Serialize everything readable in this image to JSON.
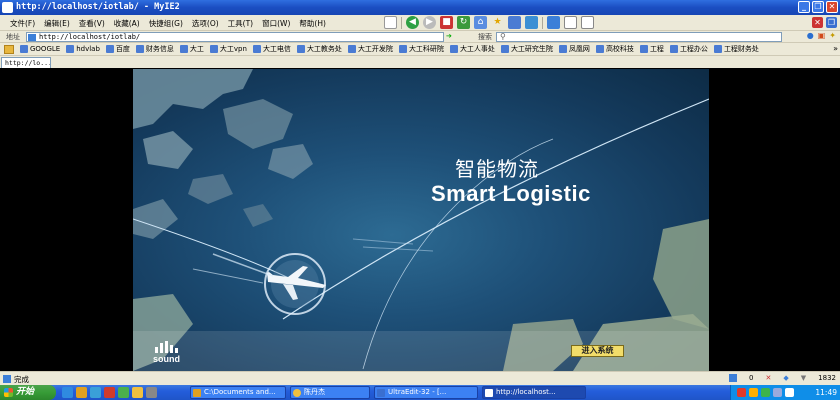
{
  "window": {
    "title": "http://localhost/iotlab/ - MyIE2",
    "minimize_glyph": "_",
    "restore_glyph": "❐",
    "close_glyph": "✕"
  },
  "menu": {
    "items": [
      "文件(F)",
      "编辑(E)",
      "查看(V)",
      "收藏(A)",
      "快捷组(G)",
      "选项(O)",
      "工具(T)",
      "窗口(W)",
      "帮助(H)"
    ]
  },
  "address": {
    "label": "地址",
    "url": "http://localhost/iotlab/",
    "search_label": "搜索"
  },
  "favorites": {
    "items": [
      "GOOGLE",
      "hdvlab",
      "百度",
      "财务信息",
      "大工",
      "大工vpn",
      "大工电信",
      "大工教务处",
      "大工开发院",
      "大工科研院",
      "大工人事处",
      "大工研究生院",
      "凤凰网",
      "高校科技",
      "工程",
      "工程办公",
      "工程财务处"
    ],
    "more_glyph": "»"
  },
  "tab": {
    "label": "http://lo..."
  },
  "hero": {
    "title_cn": "智能物流",
    "title_en": "Smart  Logistic",
    "sound_label": "sound",
    "enter_label": "进入系统"
  },
  "status": {
    "text": "完成",
    "count": "0",
    "size": "1832"
  },
  "taskbar": {
    "start_label": "开始",
    "tasks": [
      "C:\\Documents and...",
      "陈丹杰",
      "UltraEdit-32 - [...",
      "http://localhost..."
    ],
    "clock": "11:49"
  },
  "colors": {
    "titlebar": "#1b4ec2",
    "chrome": "#ece9d8",
    "taskbar": "#245edb",
    "start": "#379c37",
    "enter_button": "#f2dd6a"
  }
}
